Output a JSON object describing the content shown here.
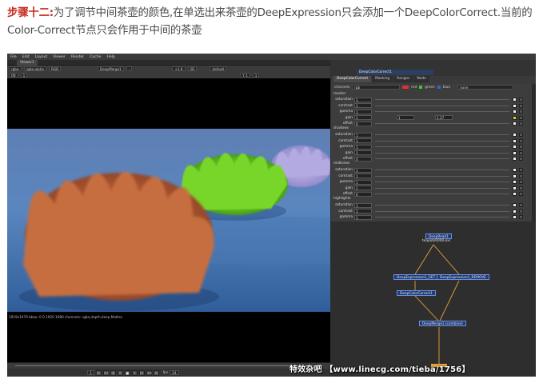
{
  "caption": {
    "step": "步骤十二:",
    "line1": "为了调节中间茶壶的颜色,在单选出来茶壶的DeepExpression只会添加一个DeepColorCorrect.当前的",
    "line2": "Color-Correct节点只会作用于中间的茶壶"
  },
  "menu": [
    "File",
    "Edit",
    "Layout",
    "Viewer",
    "Render",
    "Cache",
    "Help"
  ],
  "viewer": {
    "tab": "Viewer1",
    "bar1": [
      "rgba",
      "rgba.alpha",
      "RGB",
      "DeepMerge1",
      "-",
      "+1.0",
      "2D",
      "default"
    ],
    "bar2": [
      "f/8",
      "1",
      "Y 1",
      "1"
    ],
    "status": "1919x1079 bbox: 0 0 1920 1080 channels: rgba,depth,deep.Mattes"
  },
  "transport": {
    "frame": "1",
    "fps_label": "fps",
    "fps": "24",
    "buttons": [
      "|<",
      "<<",
      "<|",
      "<",
      "■",
      ">",
      "|>",
      ">>",
      ">|"
    ]
  },
  "properties": {
    "node_name": "DeepColorCorrect1",
    "tabs": [
      "DeepColorCorrect",
      "Masking",
      "Ranges",
      "Node"
    ],
    "channels_label": "channels",
    "channels_value": "rgb",
    "channel_checks": [
      "red",
      "green",
      "blue"
    ],
    "channel_extra": "none",
    "master_label": "master",
    "master": [
      {
        "label": "saturation",
        "value": "1"
      },
      {
        "label": "contrast",
        "value": "1"
      },
      {
        "label": "gamma",
        "value": "1"
      },
      {
        "label": "gain",
        "value": "1",
        "v2": "1",
        "v3": "1.27"
      },
      {
        "label": "offset",
        "value": "0"
      }
    ],
    "shadows_label": "shadows",
    "shadows": [
      {
        "label": "saturation",
        "value": "1"
      },
      {
        "label": "contrast",
        "value": "1"
      },
      {
        "label": "gamma",
        "value": "1"
      },
      {
        "label": "gain",
        "value": "1"
      },
      {
        "label": "offset",
        "value": "0"
      }
    ],
    "midtones_label": "midtones",
    "midtones": [
      {
        "label": "saturation",
        "value": "1"
      },
      {
        "label": "contrast",
        "value": "1"
      },
      {
        "label": "gamma",
        "value": "1"
      },
      {
        "label": "gain",
        "value": "1"
      },
      {
        "label": "offset",
        "value": "0"
      }
    ],
    "highlights_label": "highlights",
    "highlights": [
      {
        "label": "saturation",
        "value": "1"
      },
      {
        "label": "contrast",
        "value": "1"
      },
      {
        "label": "gamma",
        "value": "1"
      }
    ]
  },
  "nodegraph": {
    "read_name": "DeepRead1",
    "read_file": "teapots0000.exr",
    "expr_get": "DeepExpression1_GET",
    "expr_remove": "DeepExpression1_REMOVE",
    "color_correct": "DeepColorCorrect1",
    "merge": "DeepMerge1 (combine)"
  },
  "watermark": "特效杂吧 【www.linecg.com/tieba/1756】",
  "colors": {
    "accent": "#c62a1d",
    "node_blue": "#1e3a7a",
    "pipe": "#e2a43c"
  }
}
